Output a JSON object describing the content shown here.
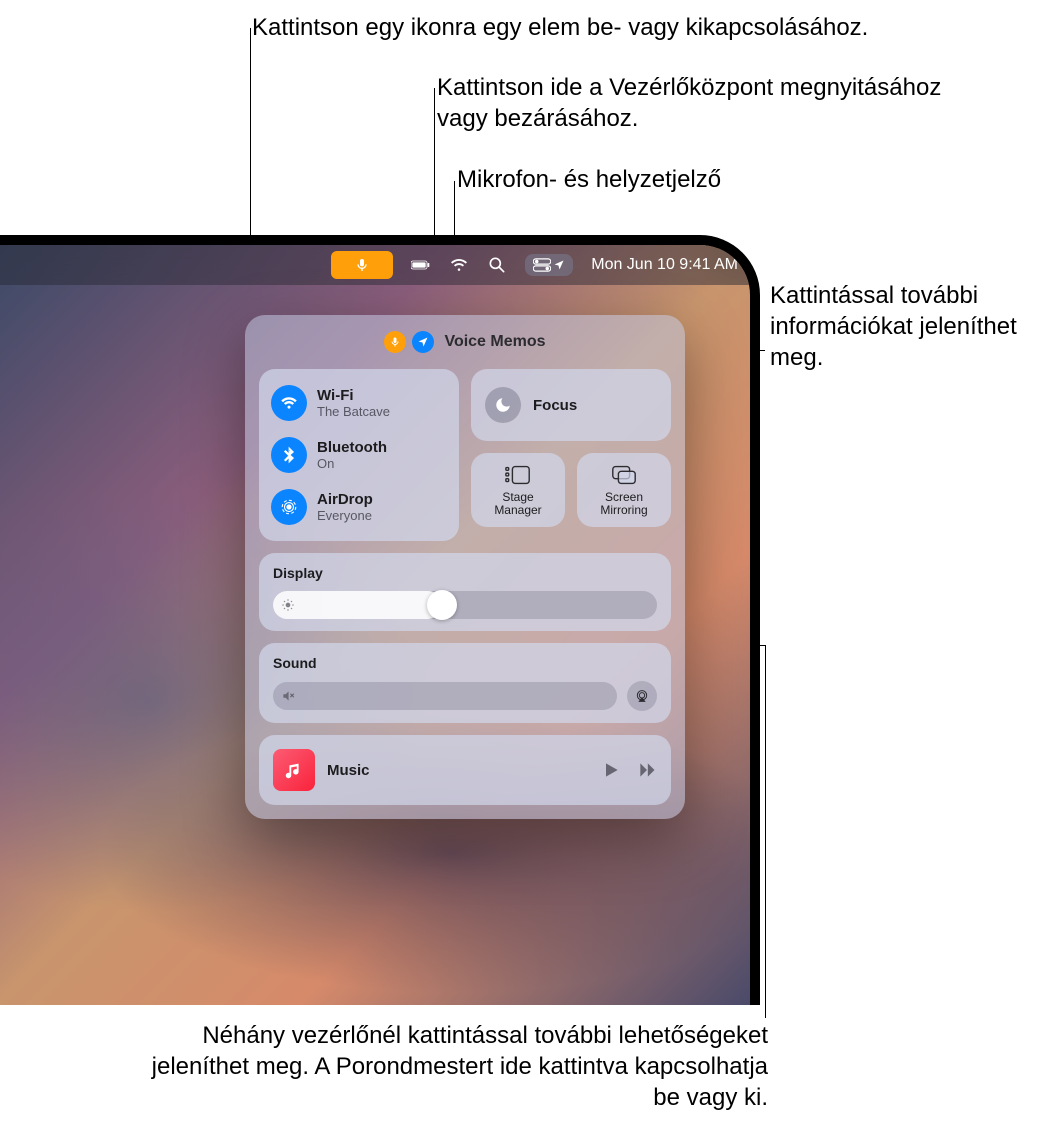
{
  "callouts": {
    "toggle": "Kattintson egy ikonra egy elem be- vagy kikapcsolásához.",
    "open_close": "Kattintson ide a Vezérlőközpont megnyitásához vagy bezárásához.",
    "mic_loc": "Mikrofon- és helyzetjelző",
    "more_info": "Kattintással további információkat jeleníthet meg.",
    "bottom": "Néhány vezérlőnél kattintással további lehetőségeket jeleníthet meg. A Porondmestert ide kattintva kapcsolhatja be vagy ki."
  },
  "menubar": {
    "datetime": "Mon Jun 10  9:41 AM"
  },
  "info_bar": {
    "app": "Voice Memos"
  },
  "connectivity": {
    "wifi": {
      "title": "Wi-Fi",
      "sub": "The Batcave"
    },
    "bluetooth": {
      "title": "Bluetooth",
      "sub": "On"
    },
    "airdrop": {
      "title": "AirDrop",
      "sub": "Everyone"
    }
  },
  "focus": {
    "label": "Focus"
  },
  "mini": {
    "stage": "Stage Manager",
    "mirror": "Screen Mirroring"
  },
  "display": {
    "label": "Display",
    "value_percent": 42
  },
  "sound": {
    "label": "Sound",
    "value_percent": 0
  },
  "music": {
    "name": "Music"
  }
}
